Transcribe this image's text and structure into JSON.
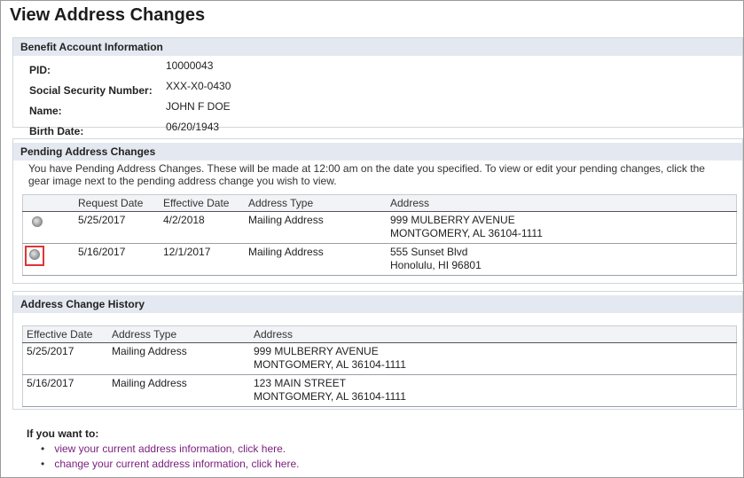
{
  "page": {
    "title": "View Address Changes"
  },
  "benefit": {
    "header": "Benefit Account Information",
    "rows": [
      {
        "label": "PID:",
        "value": "10000043"
      },
      {
        "label": "Social Security Number:",
        "value": "XXX-X0-0430"
      },
      {
        "label": "Name:",
        "value": "JOHN F DOE"
      },
      {
        "label": "Birth Date:",
        "value": "06/20/1943"
      }
    ]
  },
  "pending": {
    "header": "Pending Address Changes",
    "text": "You have Pending Address Changes. These will be made at 12:00 am on the date you specified. To view or edit your pending changes, click the gear image next to the pending address change you wish to view.",
    "columns": [
      "Request Date",
      "Effective Date",
      "Address Type",
      "Address"
    ],
    "rows": [
      {
        "request_date": "5/25/2017",
        "effective_date": "4/2/2018",
        "address_type": "Mailing Address",
        "address_line1": "999 MULBERRY AVENUE",
        "address_line2": "MONTGOMERY, AL 36104-1111",
        "icon": "gear-icon",
        "highlighted": false
      },
      {
        "request_date": "5/16/2017",
        "effective_date": "12/1/2017",
        "address_type": "Mailing Address",
        "address_line1": "555 Sunset Blvd",
        "address_line2": "Honolulu, HI 96801",
        "icon": "gear-icon",
        "highlighted": true
      }
    ]
  },
  "history": {
    "header": "Address Change History",
    "columns": [
      "Effective Date",
      "Address Type",
      "Address"
    ],
    "rows": [
      {
        "effective_date": "5/25/2017",
        "address_type": "Mailing Address",
        "address_line1": "999 MULBERRY AVENUE",
        "address_line2": "MONTGOMERY, AL 36104-1111"
      },
      {
        "effective_date": "5/16/2017",
        "address_type": "Mailing Address",
        "address_line1": "123 MAIN STREET",
        "address_line2": "MONTGOMERY, AL 36104-1111"
      }
    ]
  },
  "footer": {
    "intro": "If you want to:",
    "links": [
      "view your current address information, click here.",
      "change your current address information, click here."
    ]
  },
  "colors": {
    "header_bg": "#e4e9f1",
    "link": "#7a1d7e",
    "highlight": "#e03434"
  }
}
